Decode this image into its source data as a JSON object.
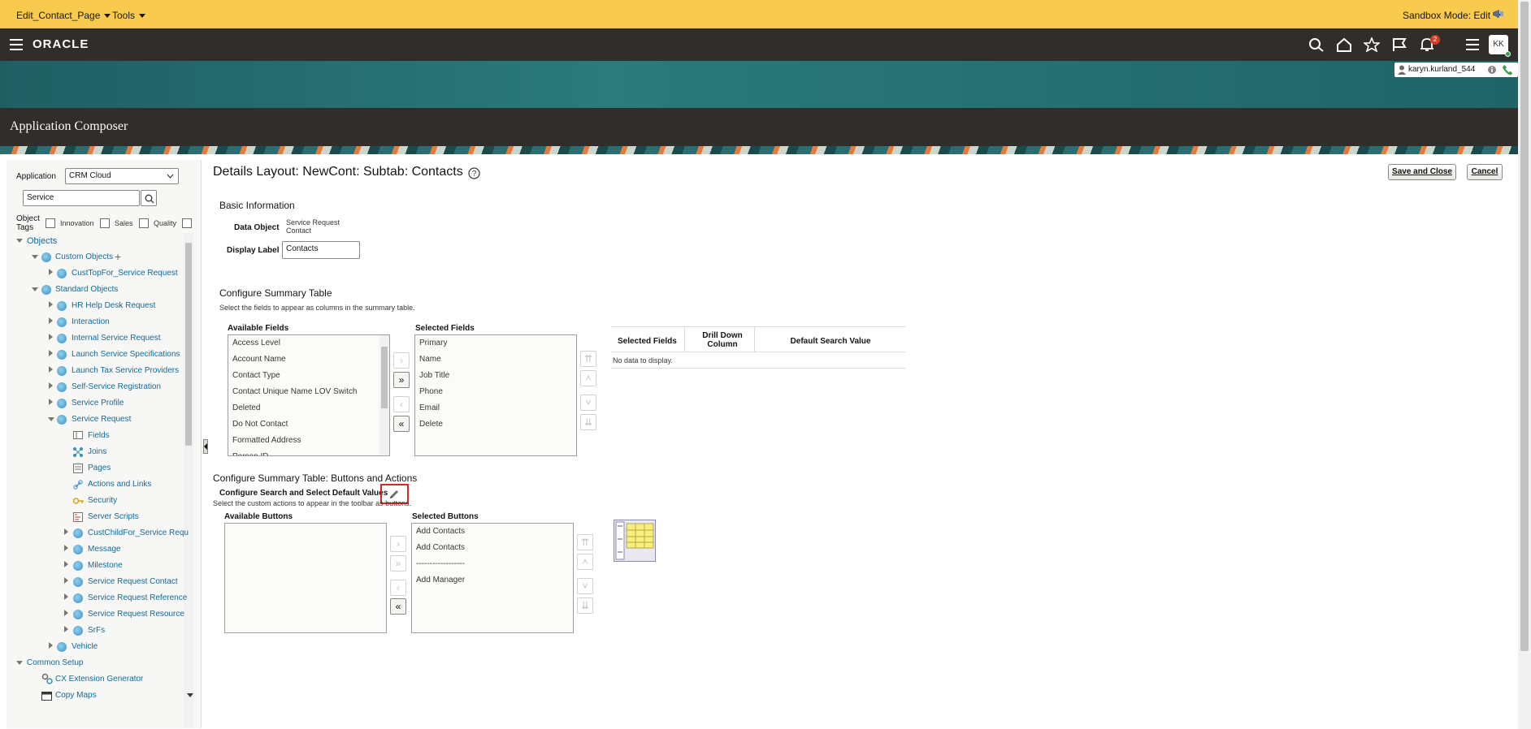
{
  "sandbox": {
    "page_menu": "Edit_Contact_Page",
    "tools_menu": "Tools",
    "mode": "Sandbox Mode: Edit"
  },
  "header": {
    "logo": "ORACLE",
    "notification_count": "2",
    "avatar_initials": "KK",
    "username": "karyn.kurland_544"
  },
  "app_title": "Application Composer",
  "left": {
    "application_label": "Application",
    "application_value": "CRM Cloud",
    "search_value": "Service",
    "object_tags_label": "Object Tags",
    "tags": [
      "Innovation",
      "Sales",
      "Quality"
    ],
    "tree": {
      "objects": "Objects",
      "custom_objects": "Custom Objects",
      "cust_top": "CustTopFor_Service Request",
      "standard_objects": "Standard Objects",
      "standard_items": [
        "HR Help Desk Request",
        "Interaction",
        "Internal Service Request",
        "Launch Service Specifications",
        "Launch Tax Service Providers",
        "Self-Service Registration",
        "Service Profile",
        "Service Request"
      ],
      "sr_children": [
        "Fields",
        "Joins",
        "Pages",
        "Actions and Links",
        "Security",
        "Server Scripts"
      ],
      "sr_subobjects": [
        "CustChildFor_Service Requ",
        "Message",
        "Milestone",
        "Service Request Contact",
        "Service Request Reference",
        "Service Request Resource",
        "SrFs"
      ],
      "vehicle": "Vehicle",
      "common_setup": "Common Setup",
      "common_items": [
        "CX Extension Generator",
        "Copy Maps"
      ]
    }
  },
  "main": {
    "page_title": "Details Layout: NewCont: Subtab: Contacts",
    "save_close": "Save and Close",
    "cancel": "Cancel",
    "basic_info": "Basic Information",
    "data_object_label": "Data Object",
    "data_object_value_1": "Service Request",
    "data_object_value_2": "Contact",
    "display_label_label": "Display Label",
    "display_label_value": "Contacts",
    "summary_title": "Configure Summary Table",
    "summary_desc": "Select the fields to appear as columns in the summary table.",
    "available_fields_title": "Available Fields",
    "available_fields": [
      "Access Level",
      "Account Name",
      "Contact Type",
      "Contact Unique Name LOV Switch",
      "Deleted",
      "Do Not Contact",
      "Formatted Address",
      "Person ID"
    ],
    "selected_fields_title": "Selected Fields",
    "selected_fields": [
      "Primary",
      "Name",
      "Job Title",
      "Phone",
      "Email",
      "Delete"
    ],
    "table_headers": [
      "Selected Fields",
      "Drill Down Column",
      "Default Search Value"
    ],
    "no_data": "No data to display.",
    "buttons_title": "Configure Summary Table: Buttons and Actions",
    "search_defaults": "Configure Search and Select Default Values",
    "buttons_desc": "Select the custom actions to appear in the toolbar as buttons.",
    "available_buttons_title": "Available Buttons",
    "selected_buttons_title": "Selected Buttons",
    "selected_buttons": [
      "Add Contacts",
      "Add Contacts",
      "------------------",
      "Add Manager"
    ]
  },
  "colors": {
    "sandbox_bar": "#f8cb4f",
    "header_dark": "#312d2a",
    "link": "#0f6b9b",
    "highlight": "#d62828"
  }
}
